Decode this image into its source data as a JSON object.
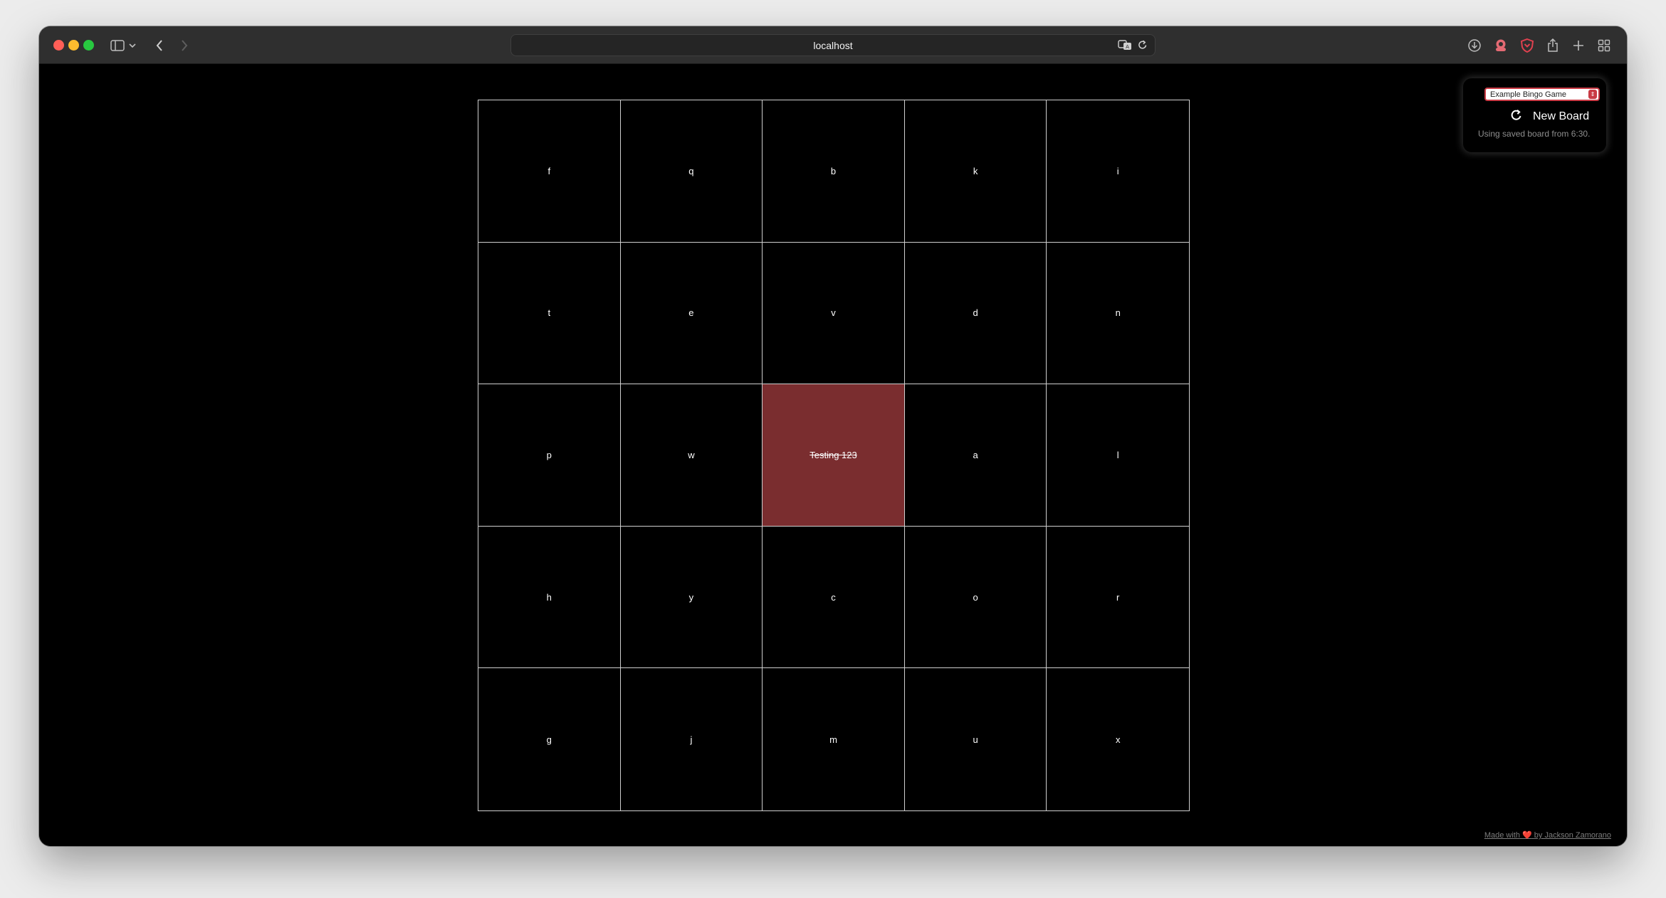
{
  "browser": {
    "address": "localhost",
    "colors": {
      "close": "#ff5f57",
      "minimize": "#febc2e",
      "zoom": "#28c840"
    },
    "icons": {
      "toolbar_left": [
        "sidebar-icon",
        "chevron-down-icon",
        "back-icon",
        "forward-icon"
      ],
      "address": [
        "translate-icon",
        "reload-icon"
      ],
      "toolbar_right": [
        "download-icon",
        "extension-icon",
        "shield-icon",
        "share-icon",
        "new-tab-icon",
        "tab-overview-icon"
      ]
    }
  },
  "controls": {
    "game_select_value": "Example Bingo Game",
    "new_board_label": "New Board",
    "saved_note": "Using saved board from 6:30."
  },
  "board": {
    "cells": [
      "f",
      "q",
      "b",
      "k",
      "i",
      "t",
      "e",
      "v",
      "d",
      "n",
      "p",
      "w",
      "Testing 123",
      "a",
      "l",
      "h",
      "y",
      "c",
      "o",
      "r",
      "g",
      "j",
      "m",
      "u",
      "x"
    ],
    "marked_color": "#7a2d2f",
    "marked_index": 12
  },
  "footer": {
    "prefix": "Made with",
    "heart": "❤️",
    "suffix": "by Jackson Zamorano"
  }
}
